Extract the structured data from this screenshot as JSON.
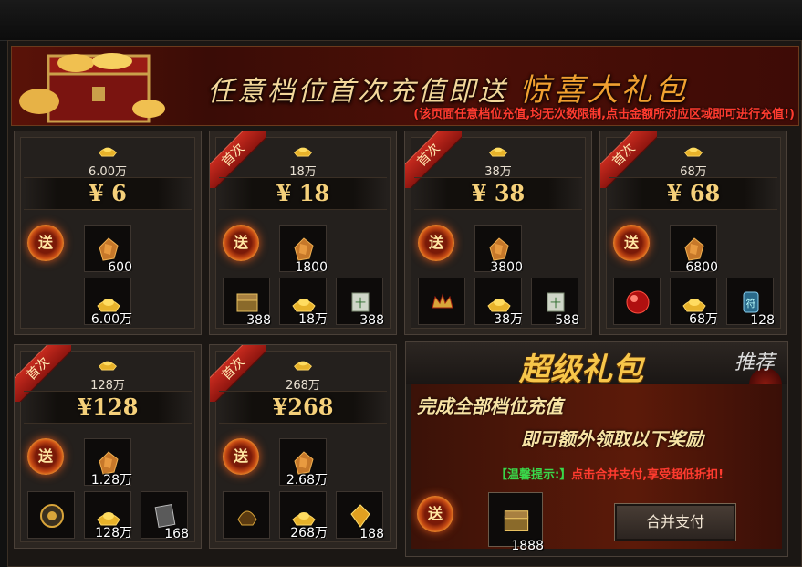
{
  "banner": {
    "title_main": "任意档位首次充值即送",
    "title_highlight": "惊喜大礼包",
    "note": "(该页面任意档位充值,均无次数限制,点击金额所对应区域即可进行充值!)"
  },
  "first_badge": "首次",
  "send_label": "送",
  "tiers": [
    {
      "ingot": "6.00万",
      "price": "¥ 6",
      "first": false,
      "items": [
        {
          "icon": "ore-icon",
          "count": "600"
        },
        {
          "icon": "gold-ingot-icon",
          "count": "6.00万"
        }
      ]
    },
    {
      "ingot": "18万",
      "price": "¥ 18",
      "first": true,
      "items": [
        {
          "icon": "ore-icon",
          "count": "1800"
        },
        {
          "icon": "treasure-chest-icon",
          "count": "388"
        },
        {
          "icon": "gold-ingot-icon",
          "count": "18万"
        },
        {
          "icon": "scroll-icon",
          "count": "388"
        }
      ]
    },
    {
      "ingot": "38万",
      "price": "¥ 38",
      "first": true,
      "items": [
        {
          "icon": "ore-icon",
          "count": "3800"
        },
        {
          "icon": "crown-icon",
          "count": ""
        },
        {
          "icon": "gold-ingot-icon",
          "count": "38万"
        },
        {
          "icon": "scroll-icon",
          "count": "588"
        }
      ]
    },
    {
      "ingot": "68万",
      "price": "¥ 68",
      "first": true,
      "items": [
        {
          "icon": "ore-icon",
          "count": "6800"
        },
        {
          "icon": "red-orb-icon",
          "count": ""
        },
        {
          "icon": "gold-ingot-icon",
          "count": "68万"
        },
        {
          "icon": "blue-rune-icon",
          "count": "128"
        }
      ]
    },
    {
      "ingot": "128万",
      "price": "¥128",
      "first": true,
      "items": [
        {
          "icon": "ore-icon",
          "count": "1.28万"
        },
        {
          "icon": "wheel-icon",
          "count": ""
        },
        {
          "icon": "gold-ingot-icon",
          "count": "128万"
        },
        {
          "icon": "book-icon",
          "count": "168"
        }
      ]
    },
    {
      "ingot": "268万",
      "price": "¥268",
      "first": true,
      "items": [
        {
          "icon": "ore-icon",
          "count": "2.68万"
        },
        {
          "icon": "helmet-icon",
          "count": ""
        },
        {
          "icon": "gold-ingot-icon",
          "count": "268万"
        },
        {
          "icon": "crystal-icon",
          "count": "188"
        }
      ]
    }
  ],
  "super_pack": {
    "title": "超级礼包",
    "recommend": "推荐",
    "line1": "完成全部档位充值",
    "line2": "即可额外领取以下奖励",
    "tip_label": "【温馨提示:】",
    "tip_text": "点击合并支付,享受超低折扣!",
    "reward_count": "1888",
    "merge_button": "合并支付"
  },
  "colors": {
    "gold": "#f5d07a",
    "red": "#ff3b2f",
    "green": "#39d84a",
    "ribbon": "#c62a1e"
  }
}
